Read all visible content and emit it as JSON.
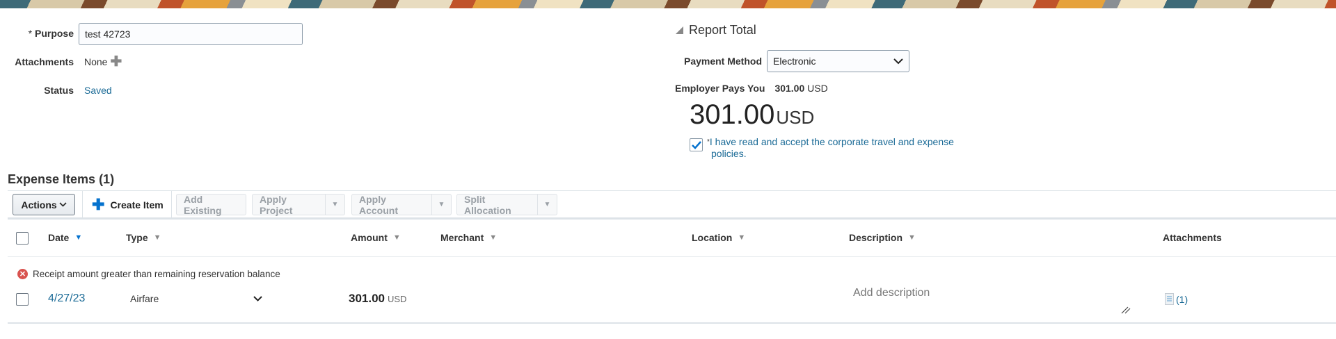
{
  "header": {
    "purpose": {
      "required_mark": "*",
      "label": "Purpose",
      "value": "test 42723"
    },
    "attachments": {
      "label": "Attachments",
      "value": "None"
    },
    "status": {
      "label": "Status",
      "value": "Saved"
    }
  },
  "report_total": {
    "title": "Report Total",
    "payment_method": {
      "label": "Payment Method",
      "value": "Electronic"
    },
    "employer_pays": {
      "label": "Employer Pays You",
      "amount": "301.00",
      "currency": "USD"
    },
    "total": {
      "amount": "301.00",
      "currency": "USD"
    },
    "policy": {
      "required_mark": "*",
      "text": "I have read and accept the corporate travel and expense policies.",
      "checked": true
    }
  },
  "expense_items": {
    "title": "Expense Items (1)",
    "toolbar": {
      "actions": "Actions",
      "create": "Create Item",
      "add_existing": "Add Existing",
      "apply_project": "Apply Project",
      "apply_account": "Apply Account",
      "split_allocation": "Split Allocation"
    },
    "columns": {
      "date": "Date",
      "type": "Type",
      "amount": "Amount",
      "merchant": "Merchant",
      "location": "Location",
      "description": "Description",
      "attachments": "Attachments"
    },
    "rows": [
      {
        "error": "Receipt amount greater than remaining reservation balance",
        "date": "4/27/23",
        "type": "Airfare",
        "amount": "301.00",
        "currency": "USD",
        "description_placeholder": "Add description",
        "attachments": "(1)"
      }
    ]
  },
  "colors": {
    "link": "#1a6a96",
    "error": "#d9534f",
    "accent": "#0572ce"
  }
}
